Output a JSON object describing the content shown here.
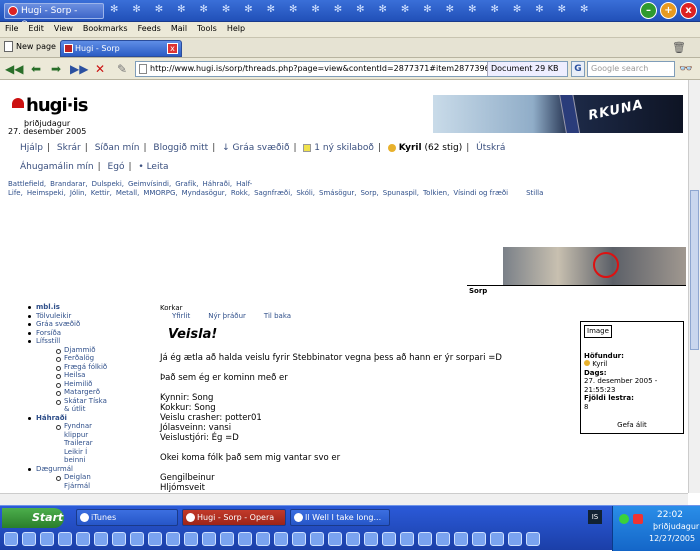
{
  "window": {
    "title": "Hugi - Sorp - Opera",
    "minimize": "–",
    "maximize": "+",
    "close": "x"
  },
  "menu": [
    "File",
    "Edit",
    "View",
    "Bookmarks",
    "Feeds",
    "Mail",
    "Tools",
    "Help"
  ],
  "tabs": {
    "new_page": "New page",
    "active_tab": "Hugi - Sorp",
    "close": "x"
  },
  "address": {
    "url": "http://www.hugi.is/sorp/threads.php?page=view&contentId=2877371#item2877396",
    "document": "Document",
    "size": "29 KB",
    "engine": "G",
    "search_placeholder": "Google search"
  },
  "site": {
    "logo": "hugi·is",
    "day": "þriðjudagur",
    "date": "27. desember 2005",
    "banner_text": "RKUNA",
    "nav_row1": [
      "Hjálp",
      "Skrár",
      "Síðan mín",
      "Bloggið mitt",
      "Gráa svæðið",
      "1 ný skilaboð",
      "Kyril",
      "(62 stig)",
      "Útskrá"
    ],
    "nav_row2": [
      "Áhugamálin mín",
      "Egó",
      "Leita"
    ],
    "categories": [
      "Battlefield,",
      "Brandarar,",
      "Dulspeki,",
      "Geimvísindi,",
      "Grafík,",
      "Háhraði,",
      "Half-Life,",
      "Heimspeki,",
      "Jólin,",
      "Kettir,",
      "Metall,",
      "MMORPG,",
      "Myndasögur,",
      "Rokk,",
      "Sagnfræði,",
      "Skóli,",
      "Smásögur,",
      "Sorp,",
      "Spunaspil,",
      "Tolkien,",
      "Vísindi og fræði",
      "Stilla"
    ],
    "section_label": "Sorp"
  },
  "sidebar": {
    "items": [
      {
        "level": 1,
        "text": "mbl.is",
        "bold": true
      },
      {
        "level": 1,
        "text": "Tölvuleikir"
      },
      {
        "level": 1,
        "text": "Gráa svæðið"
      },
      {
        "level": 1,
        "text": "Forsíða"
      },
      {
        "level": 1,
        "text": "Lífsstíll"
      },
      {
        "level": 2,
        "text": "Djammið"
      },
      {
        "level": 2,
        "text": "Ferðalög"
      },
      {
        "level": 2,
        "text": "Frægá fólkið"
      },
      {
        "level": 2,
        "text": "Heilsa"
      },
      {
        "level": 2,
        "text": "Heimilið"
      },
      {
        "level": 2,
        "text": "Matargerð"
      },
      {
        "level": 2,
        "text": "Skátar Tíska"
      },
      {
        "level": 3,
        "text": "& útlit"
      },
      {
        "level": 1,
        "text": "Háhraði",
        "bold": true
      },
      {
        "level": 2,
        "text": "Fyndnar"
      },
      {
        "level": 3,
        "text": "klippur"
      },
      {
        "level": 3,
        "text": "Trailerar"
      },
      {
        "level": 3,
        "text": "Leikir Í"
      },
      {
        "level": 3,
        "text": "beinni"
      },
      {
        "level": 1,
        "text": "Dægurmál"
      },
      {
        "level": 2,
        "text": "Deiglan"
      },
      {
        "level": 3,
        "text": "Fjármál"
      }
    ]
  },
  "post": {
    "crumb": "Korkar",
    "subnav": [
      "Yfirlit",
      "Nýr þráður",
      "Til baka"
    ],
    "title": "Veisla!",
    "lines": [
      "Já ég ætla að halda veislu fyrir Stebbinator vegna þess að hann er ýr sorpari =D",
      "",
      "Það sem ég er kominn með er",
      "",
      "Kynnir: Song",
      "Kokkur: Song",
      "Veislu crasher: potter01",
      "Jólasveinn: vansi",
      "Veislustjóri: Ég =D",
      "",
      "Okei koma fólk það sem mig vantar svo er",
      "",
      "Gengilbeinur",
      "Hljómsveit"
    ]
  },
  "info": {
    "image_label": "Image",
    "author_label": "Höfundur:",
    "author": "Kyril",
    "date_label": "Dags:",
    "date": "27. desember 2005 - 21:55:23",
    "reads_label": "Fjöldi lestra:",
    "reads": "8",
    "give_label": "Gefa álit"
  },
  "taskbar": {
    "start": "Start",
    "tasks": [
      "iTunes",
      "Hugi - Sorp - Opera",
      "Il Well I take long..."
    ],
    "is": "IS",
    "time": "22:02",
    "day": "þriðjudagur",
    "date": "12/27/2005"
  }
}
